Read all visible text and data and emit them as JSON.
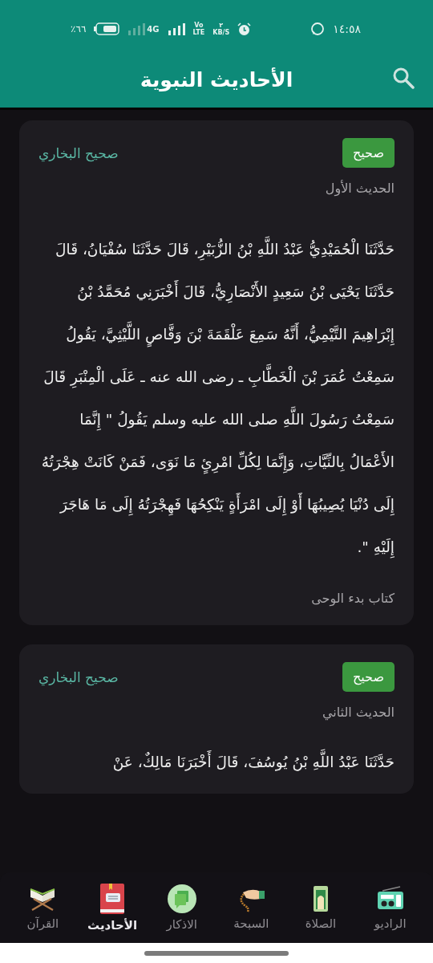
{
  "status_bar": {
    "time": "١٤:٥٨",
    "speed_value": "٢",
    "speed_unit": "KB/S",
    "volte_top": "Vo",
    "volte_bottom": "LTE",
    "network": "4G",
    "battery": "٪٦٦"
  },
  "app_bar": {
    "title": "الأحاديث النبوية"
  },
  "hadiths": [
    {
      "source": "صحيح البخاري",
      "grade": "صحيح",
      "number": "الحديث الأول",
      "text": "حَدَّثَنَا الْحُمَيْدِيُّ عَبْدُ اللَّهِ بْنُ الزُّبَيْرِ، قَالَ حَدَّثَنَا سُفْيَانُ، قَالَ حَدَّثَنَا يَحْيَى بْنُ سَعِيدٍ الأَنْصَارِيُّ، قَالَ أَخْبَرَنِي مُحَمَّدُ بْنُ إِبْرَاهِيمَ التَّيْمِيُّ، أَنَّهُ سَمِعَ عَلْقَمَةَ بْنَ وَقَّاصٍ اللَّيْثِيَّ، يَقُولُ سَمِعْتُ عُمَرَ بْنَ الْخَطَّابِ ـ رضى الله عنه ـ عَلَى الْمِنْبَرِ قَالَ سَمِعْتُ رَسُولَ اللَّهِ صلى الله عليه وسلم يَقُولُ \" إِنَّمَا الأَعْمَالُ بِالنِّيَّاتِ، وَإِنَّمَا لِكُلِّ امْرِئٍ مَا نَوَى، فَمَنْ كَانَتْ هِجْرَتُهُ إِلَى دُنْيَا يُصِيبُهَا أَوْ إِلَى امْرَأَةٍ يَنْكِحُهَا فَهِجْرَتُهُ إِلَى مَا هَاجَرَ إِلَيْهِ \".",
      "book": "كتاب بدء الوحى"
    },
    {
      "source": "صحيح البخاري",
      "grade": "صحيح",
      "number": "الحديث الثاني",
      "text": "حَدَّثَنَا عَبْدُ اللَّهِ بْنُ يُوسُفَ، قَالَ أَخْبَرَنَا مَالِكٌ، عَنْ"
    }
  ],
  "bottom_nav": [
    {
      "kind": "radio",
      "label": "الراديو",
      "selected": false
    },
    {
      "kind": "prayer",
      "label": "الصلاة",
      "selected": false
    },
    {
      "kind": "beads",
      "label": "السبحة",
      "selected": false
    },
    {
      "kind": "adhkar",
      "label": "الاذكار",
      "selected": false
    },
    {
      "kind": "hadith",
      "label": "الأحاديث",
      "selected": true
    },
    {
      "kind": "quran",
      "label": "القرآن",
      "selected": false
    }
  ]
}
